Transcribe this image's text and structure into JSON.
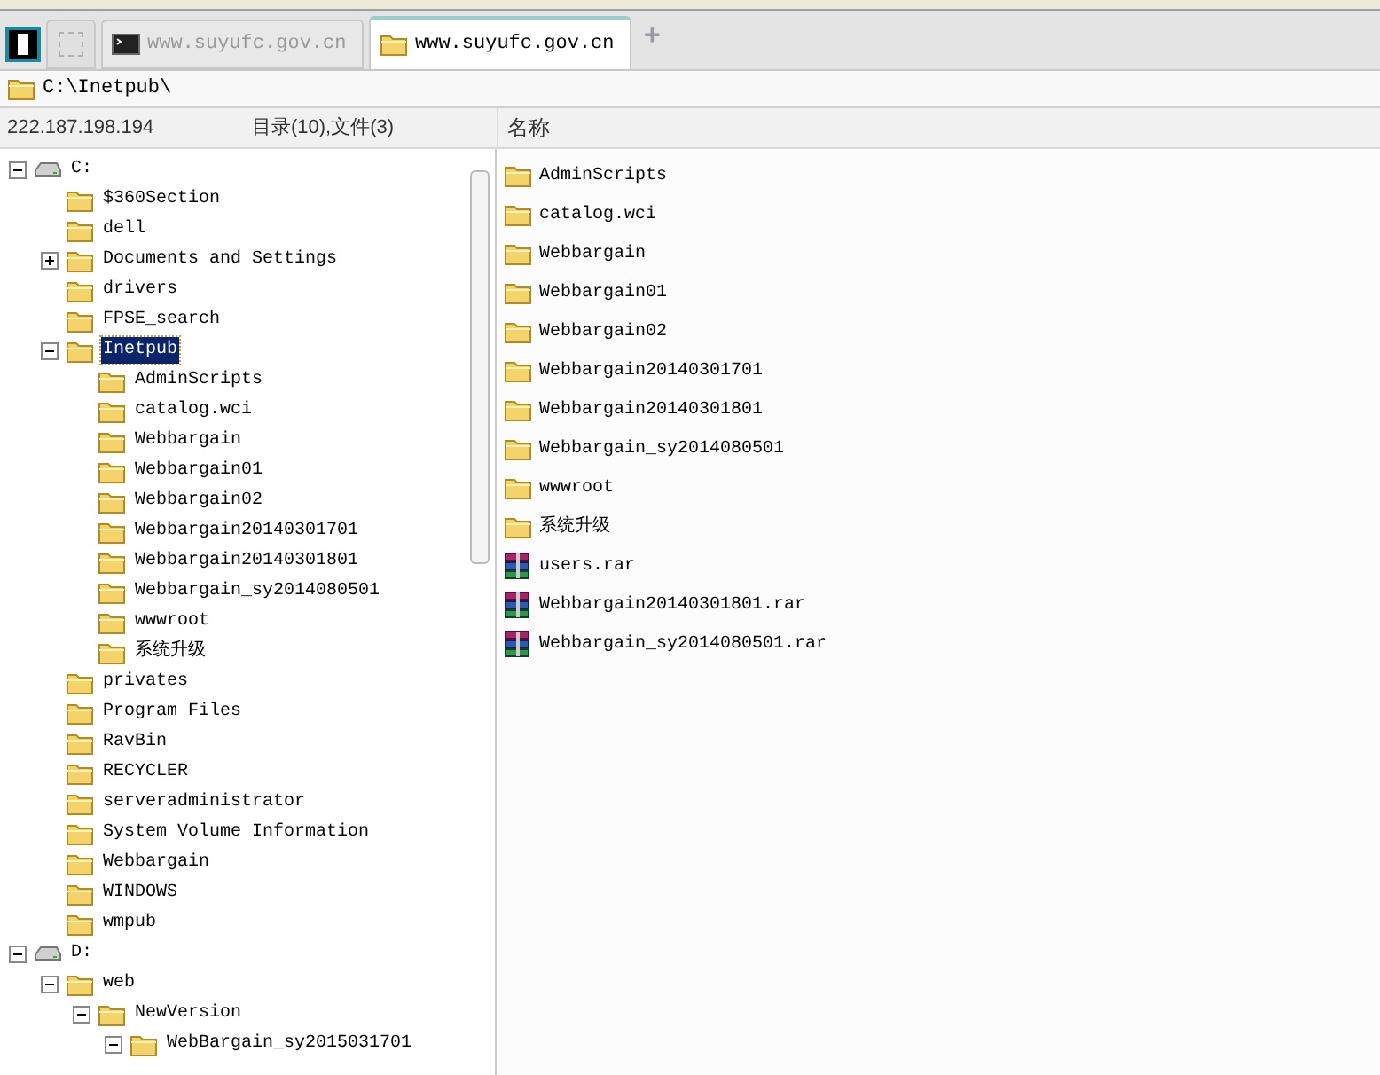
{
  "tabs": [
    {
      "kind": "terminal",
      "label": "www.suyufc.gov.cn",
      "selected": false
    },
    {
      "kind": "folder",
      "label": "www.suyufc.gov.cn",
      "selected": true
    }
  ],
  "new_tab": "+",
  "path_bar": {
    "value": "C:\\Inetpub\\"
  },
  "info": {
    "address": "222.187.198.194",
    "counts": "目录(10),文件(3)"
  },
  "tree": [
    {
      "kind": "drive",
      "label": "C:",
      "expanded": true,
      "selected": false,
      "children": [
        {
          "kind": "folder",
          "label": "$360Section",
          "selected": false
        },
        {
          "kind": "folder",
          "label": "dell",
          "selected": false
        },
        {
          "kind": "folder",
          "label": "Documents and Settings",
          "expanded": false,
          "selected": false
        },
        {
          "kind": "folder",
          "label": "drivers",
          "selected": false
        },
        {
          "kind": "folder",
          "label": "FPSE_search",
          "selected": false
        },
        {
          "kind": "folder",
          "label": "Inetpub",
          "expanded": true,
          "selected": true,
          "children": [
            {
              "kind": "folder",
              "label": "AdminScripts",
              "selected": false
            },
            {
              "kind": "folder",
              "label": "catalog.wci",
              "selected": false
            },
            {
              "kind": "folder",
              "label": "Webbargain",
              "selected": false
            },
            {
              "kind": "folder",
              "label": "Webbargain01",
              "selected": false
            },
            {
              "kind": "folder",
              "label": "Webbargain02",
              "selected": false
            },
            {
              "kind": "folder",
              "label": "Webbargain20140301701",
              "selected": false
            },
            {
              "kind": "folder",
              "label": "Webbargain20140301801",
              "selected": false
            },
            {
              "kind": "folder",
              "label": "Webbargain_sy2014080501",
              "selected": false
            },
            {
              "kind": "folder",
              "label": "wwwroot",
              "selected": false
            },
            {
              "kind": "folder",
              "label": "系统升级",
              "selected": false
            }
          ]
        },
        {
          "kind": "folder",
          "label": "privates",
          "selected": false
        },
        {
          "kind": "folder",
          "label": "Program Files",
          "selected": false
        },
        {
          "kind": "folder",
          "label": "RavBin",
          "selected": false
        },
        {
          "kind": "folder",
          "label": "RECYCLER",
          "selected": false
        },
        {
          "kind": "folder",
          "label": "serveradministrator",
          "selected": false
        },
        {
          "kind": "folder",
          "label": "System Volume Information",
          "selected": false
        },
        {
          "kind": "folder",
          "label": "Webbargain",
          "selected": false
        },
        {
          "kind": "folder",
          "label": "WINDOWS",
          "selected": false
        },
        {
          "kind": "folder",
          "label": "wmpub",
          "selected": false
        }
      ]
    },
    {
      "kind": "drive",
      "label": "D:",
      "expanded": true,
      "selected": false,
      "children": [
        {
          "kind": "folder",
          "label": "web",
          "expanded": true,
          "selected": false,
          "children": [
            {
              "kind": "folder",
              "label": "NewVersion",
              "expanded": true,
              "selected": false,
              "children": [
                {
                  "kind": "folder",
                  "label": "WebBargain_sy2015031701",
                  "expanded": true,
                  "selected": false
                }
              ]
            }
          ]
        }
      ]
    }
  ],
  "list": {
    "column": "名称",
    "items": [
      {
        "kind": "folder",
        "name": "AdminScripts"
      },
      {
        "kind": "folder",
        "name": "catalog.wci"
      },
      {
        "kind": "folder",
        "name": "Webbargain"
      },
      {
        "kind": "folder",
        "name": "Webbargain01"
      },
      {
        "kind": "folder",
        "name": "Webbargain02"
      },
      {
        "kind": "folder",
        "name": "Webbargain20140301701"
      },
      {
        "kind": "folder",
        "name": "Webbargain20140301801"
      },
      {
        "kind": "folder",
        "name": "Webbargain_sy2014080501"
      },
      {
        "kind": "folder",
        "name": "wwwroot"
      },
      {
        "kind": "folder",
        "name": "系统升级"
      },
      {
        "kind": "archive",
        "name": "users.rar"
      },
      {
        "kind": "archive",
        "name": "Webbargain20140301801.rar"
      },
      {
        "kind": "archive",
        "name": "Webbargain_sy2014080501.rar"
      }
    ]
  }
}
